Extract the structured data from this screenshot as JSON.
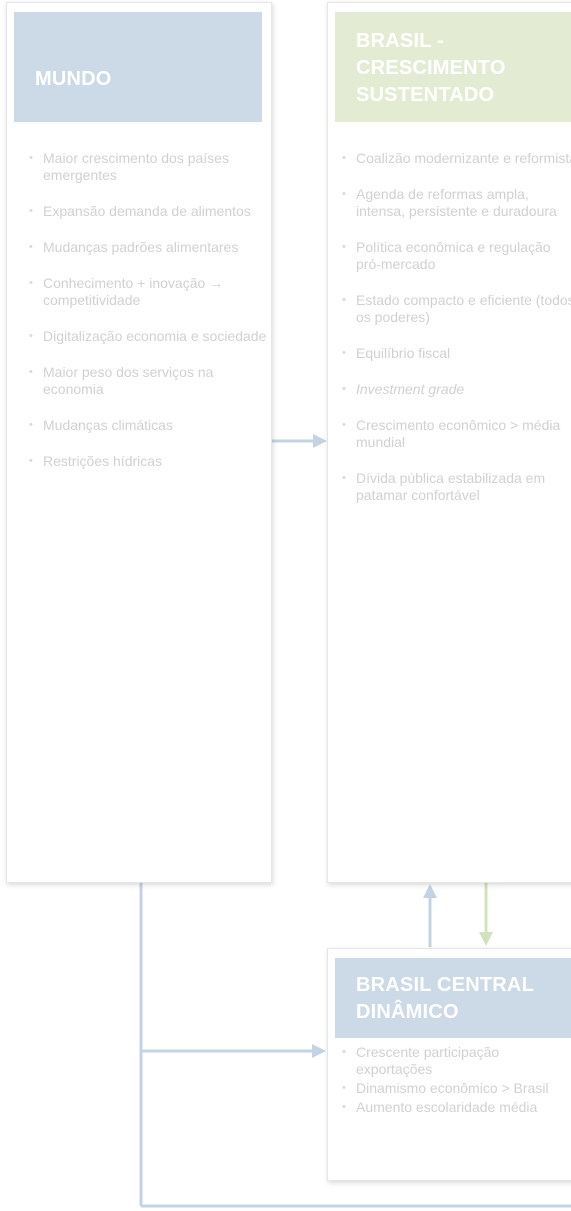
{
  "mundo": {
    "title": "MUNDO",
    "items": [
      "Maior crescimento dos países emergentes",
      "Expansão demanda de alimentos",
      "Mudanças padrões alimentares",
      "Conhecimento + inovação → competitividade",
      "Digitalização economia e sociedade",
      "Maior peso dos serviços na economia",
      "Mudanças climáticas",
      "Restrições hídricas"
    ]
  },
  "brasil": {
    "title_line1": "BRASIL -",
    "title_line2": "CRESCIMENTO",
    "title_line3": "SUSTENTADO",
    "items": [
      "Coalizão modernizante e reformista",
      "Agenda de reformas ampla, intensa, persistente e duradoura",
      "Política econômica e regulação pró-mercado",
      "Estado compacto e eficiente (todos os poderes)",
      "Equilíbrio fiscal",
      "Investment grade",
      "Crescimento econômico > média mundial",
      "Dívida pública estabilizada em patamar confortável"
    ]
  },
  "central": {
    "title_line1": "BRASIL CENTRAL",
    "title_line2": "DINÂMICO",
    "items": [
      "Crescente participação exportações",
      "Dinamismo econômico > Brasil",
      "Aumento escolaridade média"
    ]
  },
  "colors": {
    "mundo_header": "#ccd9e6",
    "brasil_header": "#e3ecd3",
    "central_header": "#ccd9e6",
    "connector_blue": "#c3d3e3",
    "connector_green": "#d2e2bd"
  }
}
